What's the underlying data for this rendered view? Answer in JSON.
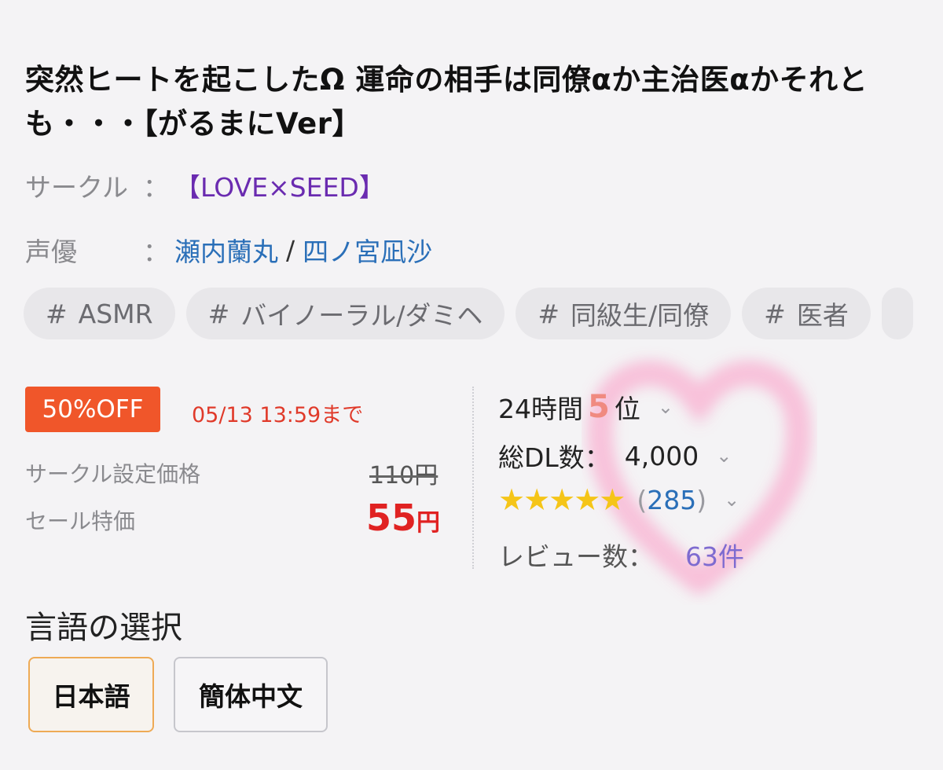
{
  "title": "突然ヒートを起こしたΩ 運命の相手は同僚αか主治医αかそれとも・・・【がるまにVer】",
  "circle": {
    "label": "サークル",
    "colon": "：",
    "name": "【LOVE×SEED】"
  },
  "voice_actors": {
    "label": "声優",
    "colon": "：",
    "names": [
      "瀬内蘭丸",
      "四ノ宮凪沙"
    ],
    "separator": "/"
  },
  "tags": [
    "ASMR",
    "バイノーラル/ダミヘ",
    "同級生/同僚",
    "医者"
  ],
  "tag_hash": "#",
  "sale": {
    "badge": "50%OFF",
    "deadline": "05/13 13:59まで",
    "circle_price_label": "サークル設定価格",
    "circle_price": "110円",
    "sale_price_label": "セール特価",
    "sale_price_number": "55",
    "sale_price_unit": "円"
  },
  "stats": {
    "rank_prefix": "24時間",
    "rank_number": "5",
    "rank_suffix": "位",
    "downloads_label": "総DL数：",
    "downloads_value": "4,000",
    "stars": "★★★★★",
    "rating_open": "(",
    "rating_count": "285",
    "rating_close": ")",
    "reviews_label": "レビュー数：",
    "reviews_value": "63件",
    "chevron": "⌄"
  },
  "language": {
    "title": "言語の選択",
    "options": [
      "日本語",
      "簡体中文"
    ]
  },
  "colors": {
    "accent_sale": "#f0562a",
    "price_red": "#e02222",
    "link_blue": "#2a6fb8",
    "circle_purple": "#6a2bb0",
    "star_yellow": "#f5c518",
    "heart_pink": "#f7a8cc"
  }
}
